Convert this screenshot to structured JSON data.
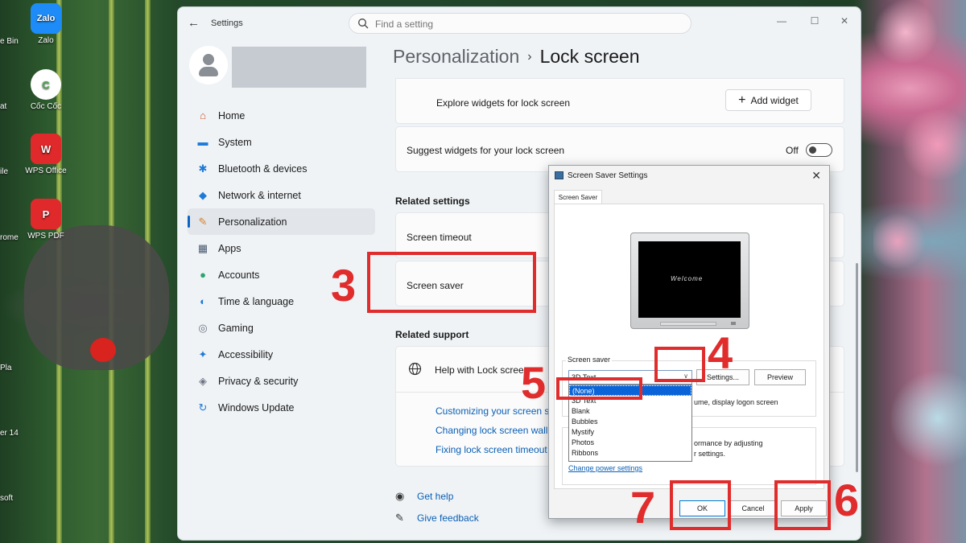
{
  "desktop": {
    "icons": [
      {
        "label": "Zalo",
        "tile": "Zalo",
        "color": "#1d8cf8"
      },
      {
        "label": "Cốc Cốc",
        "tile": "C",
        "color": "#4caf50"
      },
      {
        "label": "WPS Office",
        "tile": "W",
        "color": "#e0292a"
      },
      {
        "label": "WPS PDF",
        "tile": "P",
        "color": "#e0292a"
      }
    ],
    "fragments": [
      "e Bin",
      "at",
      "ile",
      "rome",
      "Pla",
      "er 14",
      "soft"
    ]
  },
  "window": {
    "title": "Settings",
    "search_placeholder": "Find a setting",
    "controls": {
      "minimize": "—",
      "maximize": "☐",
      "close": "✕"
    }
  },
  "nav": [
    {
      "label": "Home",
      "icon": "home-icon",
      "glyph": "⌂",
      "color": "#c65a2a"
    },
    {
      "label": "System",
      "icon": "system-icon",
      "glyph": "▬",
      "color": "#1e7ad8"
    },
    {
      "label": "Bluetooth & devices",
      "icon": "bluetooth-icon",
      "glyph": "✱",
      "color": "#1e7ad8"
    },
    {
      "label": "Network & internet",
      "icon": "wifi-icon",
      "glyph": "◆",
      "color": "#1e7ad8"
    },
    {
      "label": "Personalization",
      "icon": "paintbrush-icon",
      "glyph": "✎",
      "color": "#d9802a",
      "active": true
    },
    {
      "label": "Apps",
      "icon": "apps-icon",
      "glyph": "▦",
      "color": "#4a5a70"
    },
    {
      "label": "Accounts",
      "icon": "accounts-icon",
      "glyph": "●",
      "color": "#2aa56b"
    },
    {
      "label": "Time & language",
      "icon": "globe-icon",
      "glyph": "◐",
      "color": "#1e7ad8"
    },
    {
      "label": "Gaming",
      "icon": "gamepad-icon",
      "glyph": "◎",
      "color": "#6b7280"
    },
    {
      "label": "Accessibility",
      "icon": "accessibility-icon",
      "glyph": "✦",
      "color": "#1e7ad8"
    },
    {
      "label": "Privacy & security",
      "icon": "shield-icon",
      "glyph": "◈",
      "color": "#6b7280"
    },
    {
      "label": "Windows Update",
      "icon": "update-icon",
      "glyph": "↻",
      "color": "#1e7ad8"
    }
  ],
  "breadcrumb": {
    "parent": "Personalization",
    "separator": "›",
    "current": "Lock screen"
  },
  "main": {
    "explore_widgets": "Explore widgets for lock screen",
    "add_widget": "Add widget",
    "suggest_widgets": "Suggest widgets for your lock screen",
    "toggle_state": "Off",
    "related_settings": "Related settings",
    "screen_timeout": "Screen timeout",
    "screen_saver": "Screen saver",
    "related_support": "Related support",
    "help_lock_screen": "Help with Lock screen",
    "links": [
      "Customizing your screen sa",
      "Changing lock screen wallpa",
      "Fixing lock screen timeout"
    ],
    "get_help": "Get help",
    "give_feedback": "Give feedback"
  },
  "dialog": {
    "title": "Screen Saver Settings",
    "tab": "Screen Saver",
    "preview_text": "Welcome",
    "group_label": "Screen saver",
    "selected": "3D Text",
    "options": [
      "(None)",
      "3D Text",
      "Blank",
      "Bubbles",
      "Mystify",
      "Photos",
      "Ribbons"
    ],
    "settings_btn": "Settings...",
    "preview_btn": "Preview",
    "resume_text": "ume, display logon screen",
    "power_text1": "ormance by adjusting",
    "power_text2": "r settings.",
    "power_link": "Change power settings",
    "ok": "OK",
    "cancel": "Cancel",
    "apply": "Apply"
  },
  "annotations": [
    "3",
    "4",
    "5",
    "6",
    "7"
  ],
  "colors": {
    "accent": "#0a64c4",
    "marker": "#e02c2c",
    "link": "#0a5fb5"
  }
}
